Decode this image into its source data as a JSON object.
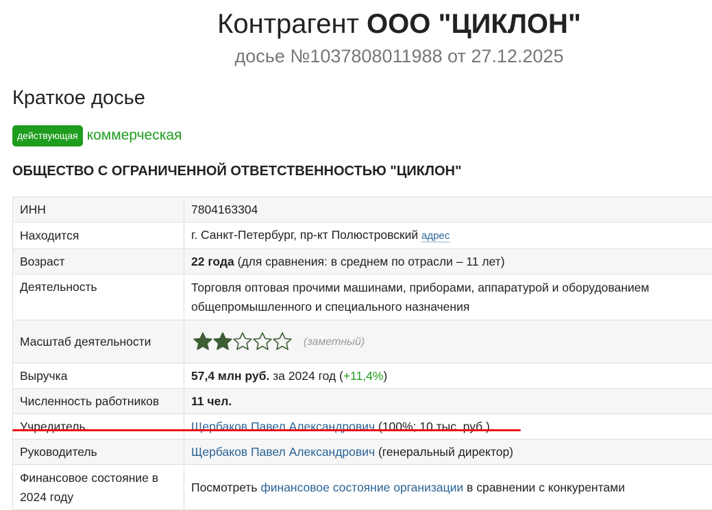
{
  "header": {
    "title_prefix": "Контрагент",
    "title_name": "ООО \"ЦИКЛОН\"",
    "subtitle": "досье №1037808011988 от 27.12.2025"
  },
  "section_title": "Краткое досье",
  "status": {
    "badge": "действующая",
    "type": "коммерческая",
    "badge_color": "#1f9d1f"
  },
  "full_name": "ОБЩЕСТВО С ОГРАНИЧЕННОЙ ОТВЕТСТВЕННОСТЬЮ \"ЦИКЛОН\"",
  "rows": {
    "inn": {
      "label": "ИНН",
      "value": "7804163304"
    },
    "location": {
      "label": "Находится",
      "value": "г. Санкт-Петербург, пр-кт Полюстровский",
      "link": "адрес"
    },
    "age": {
      "label": "Возраст",
      "value_bold": "22 года",
      "value_rest": "(для сравнения: в среднем по отрасли – 11 лет)"
    },
    "activity": {
      "label": "Деятельность",
      "value": "Торговля оптовая прочими машинами, приборами, аппаратурой и оборудованием общепромышленного и специального назначения"
    },
    "scale": {
      "label": "Масштаб деятельности",
      "rating": 2,
      "rating_max": 5,
      "note": "(заметный)",
      "star_color": "#3d5e36"
    },
    "revenue": {
      "label": "Выручка",
      "value_bold": "57,4 млн руб.",
      "value_mid": "за 2024 год (",
      "growth": "+11,4%",
      "value_end": ")"
    },
    "employees": {
      "label": "Численность работников",
      "value_bold": "11 чел."
    },
    "founder": {
      "label": "Учредитель",
      "name": "Щербаков Павел Александрович",
      "details": "(100%; 10 тыс. руб.)"
    },
    "director": {
      "label": "Руководитель",
      "name": "Щербаков Павел Александрович",
      "details": "(генеральный директор)"
    },
    "finance": {
      "label": "Финансовое состояние в 2024 году",
      "prefix": "Посмотреть",
      "link": "финансовое состояние организации",
      "suffix": "в сравнении с конкурентами"
    }
  },
  "highlight_color": "#e8101a"
}
